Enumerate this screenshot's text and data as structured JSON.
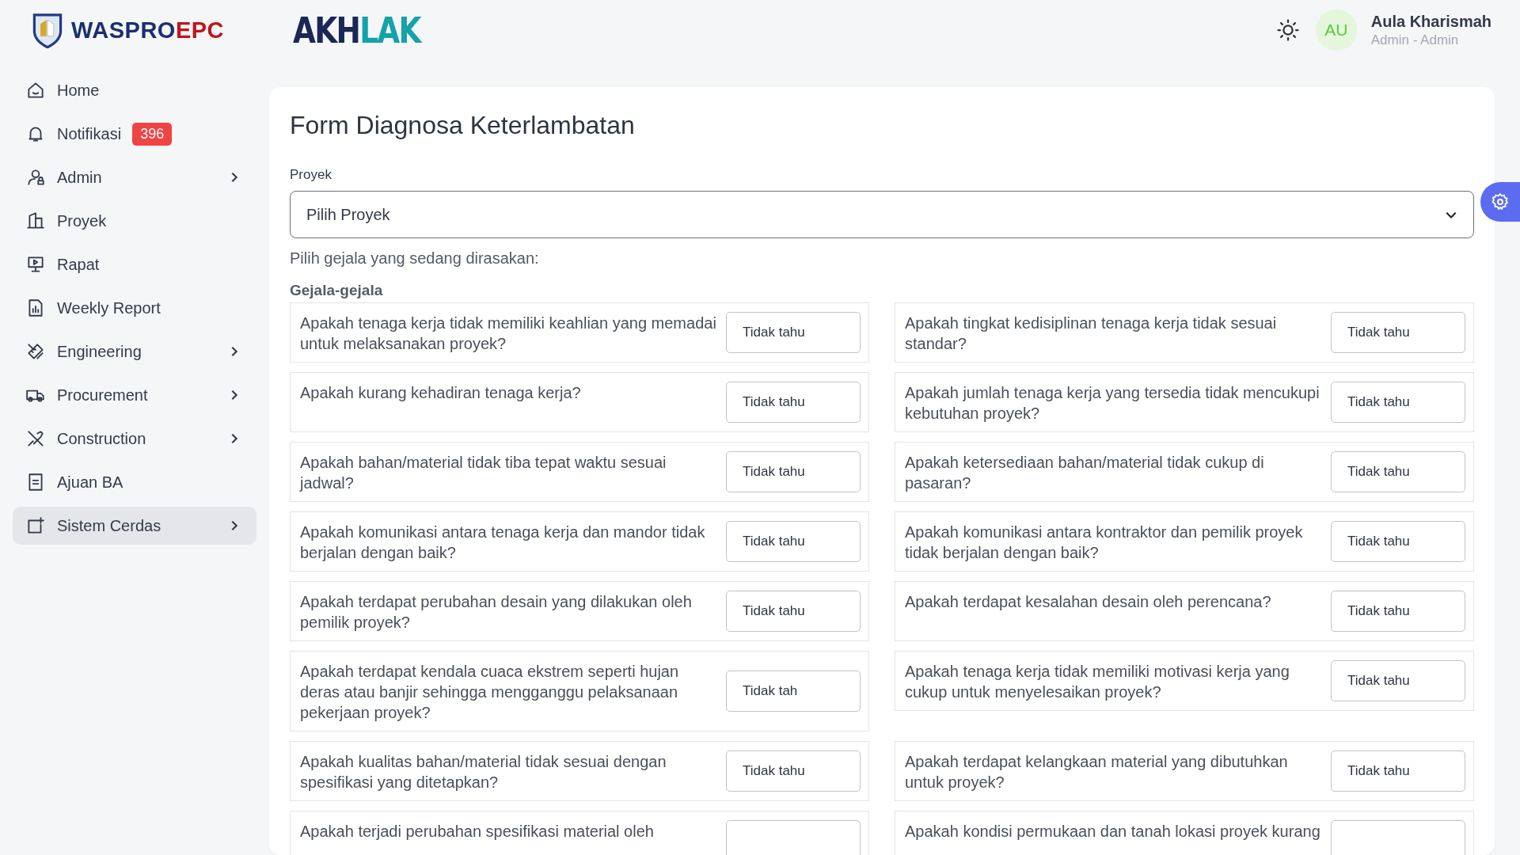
{
  "logo": {
    "word_a": "WASPRO",
    "word_b": "EPC"
  },
  "brand": {
    "word_a": "AKH",
    "word_b": "LAK"
  },
  "user": {
    "initials": "AU",
    "name": "Aula Kharismah",
    "role": "Admin - Admin"
  },
  "sidebar": {
    "items": [
      {
        "label": "Home",
        "selected": false,
        "expandable": false
      },
      {
        "label": "Notifikasi",
        "selected": false,
        "expandable": false,
        "badge": "396"
      },
      {
        "label": "Admin",
        "selected": false,
        "expandable": true
      },
      {
        "label": "Proyek",
        "selected": false,
        "expandable": false
      },
      {
        "label": "Rapat",
        "selected": false,
        "expandable": false
      },
      {
        "label": "Weekly Report",
        "selected": false,
        "expandable": false
      },
      {
        "label": "Engineering",
        "selected": false,
        "expandable": true
      },
      {
        "label": "Procurement",
        "selected": false,
        "expandable": true
      },
      {
        "label": "Construction",
        "selected": false,
        "expandable": true
      },
      {
        "label": "Ajuan BA",
        "selected": false,
        "expandable": false
      },
      {
        "label": "Sistem Cerdas",
        "selected": true,
        "expandable": true
      }
    ]
  },
  "form": {
    "title": "Form Diagnosa Keterlambatan",
    "project_label": "Proyek",
    "project_select": "Pilih Proyek",
    "instruction": "Pilih gejala yang sedang dirasakan:",
    "section": "Gejala-gejala",
    "questions": [
      {
        "text": "Apakah tenaga kerja tidak memiliki keahlian yang memadai untuk melaksanakan proyek?",
        "answer": "Tidak tahu"
      },
      {
        "text": "Apakah tingkat kedisiplinan tenaga kerja tidak sesuai standar?",
        "answer": "Tidak tahu"
      },
      {
        "text": "Apakah kurang kehadiran tenaga kerja?",
        "answer": "Tidak tahu"
      },
      {
        "text": "Apakah jumlah tenaga kerja yang tersedia tidak mencukupi kebutuhan proyek?",
        "answer": "Tidak tahu"
      },
      {
        "text": "Apakah bahan/material tidak tiba tepat waktu sesuai jadwal?",
        "answer": "Tidak tahu"
      },
      {
        "text": "Apakah ketersediaan bahan/material tidak cukup di pasaran?",
        "answer": "Tidak tahu"
      },
      {
        "text": "Apakah komunikasi antara tenaga kerja dan mandor tidak berjalan dengan baik?",
        "answer": "Tidak tahu"
      },
      {
        "text": "Apakah komunikasi antara kontraktor dan pemilik proyek tidak berjalan dengan baik?",
        "answer": "Tidak tahu"
      },
      {
        "text": "Apakah terdapat perubahan desain yang dilakukan oleh pemilik proyek?",
        "answer": "Tidak tahu"
      },
      {
        "text": "Apakah terdapat kesalahan desain oleh perencana?",
        "answer": "Tidak tahu"
      },
      {
        "text": "Apakah terdapat kendala cuaca ekstrem seperti hujan deras atau banjir sehingga mengganggu pelaksanaan pekerjaan proyek?",
        "answer": "Tidak tah"
      },
      {
        "text": "Apakah tenaga kerja tidak memiliki motivasi kerja yang cukup untuk menyelesaikan proyek?",
        "answer": "Tidak tahu"
      },
      {
        "text": "Apakah kualitas bahan/material tidak sesuai dengan spesifikasi yang ditetapkan?",
        "answer": "Tidak tahu"
      },
      {
        "text": "Apakah terdapat kelangkaan material yang dibutuhkan untuk proyek?",
        "answer": "Tidak tahu"
      },
      {
        "text": "Apakah terjadi perubahan spesifikasi material oleh"
      },
      {
        "text": "Apakah kondisi permukaan dan tanah lokasi proyek kurang"
      }
    ]
  }
}
